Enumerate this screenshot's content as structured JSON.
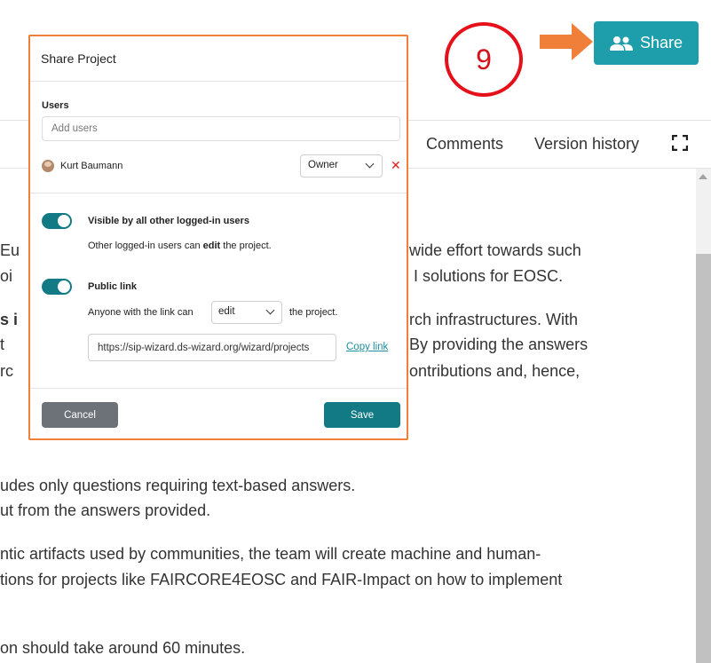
{
  "header": {
    "share_label": "Share",
    "step_number": "9"
  },
  "tabs": {
    "comments": "Comments",
    "version_history": "Version history"
  },
  "background_text": [
    "Eu",
    "wide effort towards such",
    "oi",
    "I solutions for EOSC.",
    "s i",
    "rch infrastructures. With",
    "t",
    "By providing the answers",
    "rc",
    "ontributions and, hence,",
    "udes only questions requiring text-based answers.",
    "ut from the answers provided.",
    "ntic artifacts used by communities, the team will create machine and human-",
    "tions for projects like FAIRCORE4EOSC and FAIR-Impact on how to implement",
    "on should take around 60 minutes."
  ],
  "modal": {
    "title": "Share Project",
    "users_label": "Users",
    "add_users_placeholder": "Add users",
    "user_name": "Kurt Baumann",
    "user_role": "Owner",
    "remove_symbol": "✕",
    "visible_title": "Visible by all other logged-in users",
    "visible_desc_pre": "Other logged-in users can ",
    "visible_desc_bold": "edit",
    "visible_desc_post": " the project.",
    "public_link_title": "Public link",
    "anyone_pre": "Anyone with the link can",
    "anyone_permission": "edit",
    "anyone_post": "the project.",
    "link_value": "https://sip-wizard.ds-wizard.org/wizard/projects",
    "copy_link": "Copy link",
    "cancel_label": "Cancel",
    "save_label": "Save",
    "visible_toggle_on": true,
    "public_toggle_on": true
  },
  "colors": {
    "accent": "#127a85",
    "share_button": "#1e9eab",
    "annotation_orange": "#f07f3a",
    "annotation_red": "#e5101a",
    "cancel": "#6c7278",
    "remove": "#e02020"
  }
}
